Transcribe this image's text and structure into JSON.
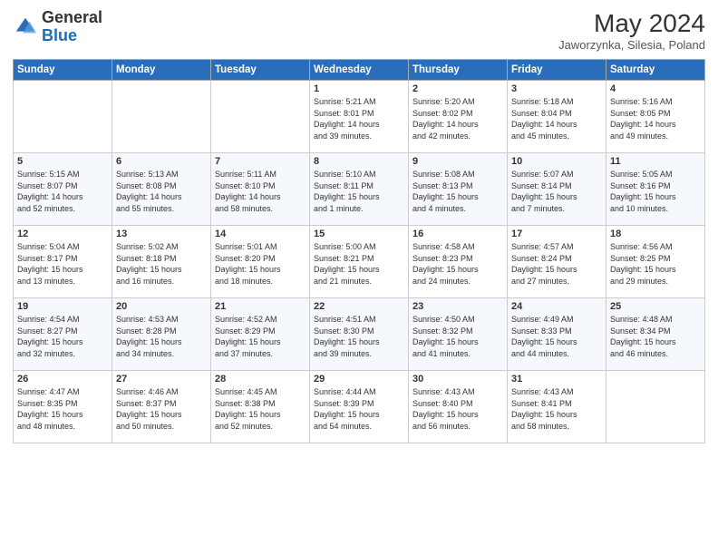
{
  "header": {
    "logo_line1": "General",
    "logo_line2": "Blue",
    "title": "May 2024",
    "subtitle": "Jaworzynka, Silesia, Poland"
  },
  "columns": [
    "Sunday",
    "Monday",
    "Tuesday",
    "Wednesday",
    "Thursday",
    "Friday",
    "Saturday"
  ],
  "weeks": [
    [
      {
        "day": "",
        "info": ""
      },
      {
        "day": "",
        "info": ""
      },
      {
        "day": "",
        "info": ""
      },
      {
        "day": "1",
        "info": "Sunrise: 5:21 AM\nSunset: 8:01 PM\nDaylight: 14 hours\nand 39 minutes."
      },
      {
        "day": "2",
        "info": "Sunrise: 5:20 AM\nSunset: 8:02 PM\nDaylight: 14 hours\nand 42 minutes."
      },
      {
        "day": "3",
        "info": "Sunrise: 5:18 AM\nSunset: 8:04 PM\nDaylight: 14 hours\nand 45 minutes."
      },
      {
        "day": "4",
        "info": "Sunrise: 5:16 AM\nSunset: 8:05 PM\nDaylight: 14 hours\nand 49 minutes."
      }
    ],
    [
      {
        "day": "5",
        "info": "Sunrise: 5:15 AM\nSunset: 8:07 PM\nDaylight: 14 hours\nand 52 minutes."
      },
      {
        "day": "6",
        "info": "Sunrise: 5:13 AM\nSunset: 8:08 PM\nDaylight: 14 hours\nand 55 minutes."
      },
      {
        "day": "7",
        "info": "Sunrise: 5:11 AM\nSunset: 8:10 PM\nDaylight: 14 hours\nand 58 minutes."
      },
      {
        "day": "8",
        "info": "Sunrise: 5:10 AM\nSunset: 8:11 PM\nDaylight: 15 hours\nand 1 minute."
      },
      {
        "day": "9",
        "info": "Sunrise: 5:08 AM\nSunset: 8:13 PM\nDaylight: 15 hours\nand 4 minutes."
      },
      {
        "day": "10",
        "info": "Sunrise: 5:07 AM\nSunset: 8:14 PM\nDaylight: 15 hours\nand 7 minutes."
      },
      {
        "day": "11",
        "info": "Sunrise: 5:05 AM\nSunset: 8:16 PM\nDaylight: 15 hours\nand 10 minutes."
      }
    ],
    [
      {
        "day": "12",
        "info": "Sunrise: 5:04 AM\nSunset: 8:17 PM\nDaylight: 15 hours\nand 13 minutes."
      },
      {
        "day": "13",
        "info": "Sunrise: 5:02 AM\nSunset: 8:18 PM\nDaylight: 15 hours\nand 16 minutes."
      },
      {
        "day": "14",
        "info": "Sunrise: 5:01 AM\nSunset: 8:20 PM\nDaylight: 15 hours\nand 18 minutes."
      },
      {
        "day": "15",
        "info": "Sunrise: 5:00 AM\nSunset: 8:21 PM\nDaylight: 15 hours\nand 21 minutes."
      },
      {
        "day": "16",
        "info": "Sunrise: 4:58 AM\nSunset: 8:23 PM\nDaylight: 15 hours\nand 24 minutes."
      },
      {
        "day": "17",
        "info": "Sunrise: 4:57 AM\nSunset: 8:24 PM\nDaylight: 15 hours\nand 27 minutes."
      },
      {
        "day": "18",
        "info": "Sunrise: 4:56 AM\nSunset: 8:25 PM\nDaylight: 15 hours\nand 29 minutes."
      }
    ],
    [
      {
        "day": "19",
        "info": "Sunrise: 4:54 AM\nSunset: 8:27 PM\nDaylight: 15 hours\nand 32 minutes."
      },
      {
        "day": "20",
        "info": "Sunrise: 4:53 AM\nSunset: 8:28 PM\nDaylight: 15 hours\nand 34 minutes."
      },
      {
        "day": "21",
        "info": "Sunrise: 4:52 AM\nSunset: 8:29 PM\nDaylight: 15 hours\nand 37 minutes."
      },
      {
        "day": "22",
        "info": "Sunrise: 4:51 AM\nSunset: 8:30 PM\nDaylight: 15 hours\nand 39 minutes."
      },
      {
        "day": "23",
        "info": "Sunrise: 4:50 AM\nSunset: 8:32 PM\nDaylight: 15 hours\nand 41 minutes."
      },
      {
        "day": "24",
        "info": "Sunrise: 4:49 AM\nSunset: 8:33 PM\nDaylight: 15 hours\nand 44 minutes."
      },
      {
        "day": "25",
        "info": "Sunrise: 4:48 AM\nSunset: 8:34 PM\nDaylight: 15 hours\nand 46 minutes."
      }
    ],
    [
      {
        "day": "26",
        "info": "Sunrise: 4:47 AM\nSunset: 8:35 PM\nDaylight: 15 hours\nand 48 minutes."
      },
      {
        "day": "27",
        "info": "Sunrise: 4:46 AM\nSunset: 8:37 PM\nDaylight: 15 hours\nand 50 minutes."
      },
      {
        "day": "28",
        "info": "Sunrise: 4:45 AM\nSunset: 8:38 PM\nDaylight: 15 hours\nand 52 minutes."
      },
      {
        "day": "29",
        "info": "Sunrise: 4:44 AM\nSunset: 8:39 PM\nDaylight: 15 hours\nand 54 minutes."
      },
      {
        "day": "30",
        "info": "Sunrise: 4:43 AM\nSunset: 8:40 PM\nDaylight: 15 hours\nand 56 minutes."
      },
      {
        "day": "31",
        "info": "Sunrise: 4:43 AM\nSunset: 8:41 PM\nDaylight: 15 hours\nand 58 minutes."
      },
      {
        "day": "",
        "info": ""
      }
    ]
  ]
}
